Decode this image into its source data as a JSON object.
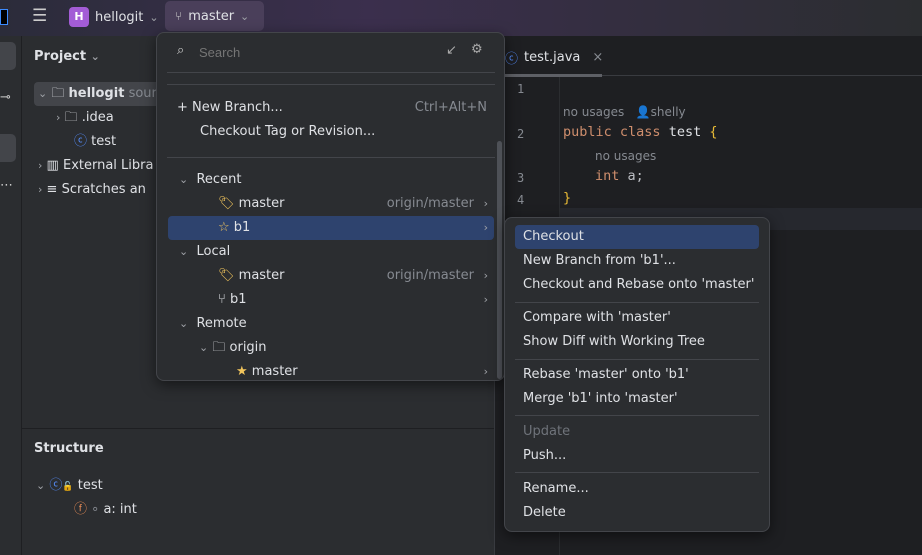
{
  "topbar": {
    "project_initial": "H",
    "project_name": "hellogit",
    "branch": "master"
  },
  "project_panel": {
    "title": "Project",
    "tree": [
      {
        "label": "hellogit",
        "suffix": "sour"
      },
      {
        "label": ".idea"
      },
      {
        "label": "test"
      },
      {
        "label": "External Libra"
      },
      {
        "label": "Scratches an"
      }
    ]
  },
  "structure_panel": {
    "title": "Structure",
    "items": [
      {
        "label": "test"
      },
      {
        "label": "a: int"
      }
    ]
  },
  "editor": {
    "tab": "test.java",
    "line_numbers": [
      "1",
      "2",
      "3",
      "4"
    ],
    "hint1": "no usages",
    "author": "shelly",
    "line2_kw1": "public",
    "line2_kw2": "class",
    "line2_name": "test",
    "line2_brace": "{",
    "hint2": "no usages",
    "line3_kw": "int",
    "line3_rest": "a;",
    "line4": "}"
  },
  "branch_popup": {
    "search_placeholder": "Search",
    "new_branch": "New Branch...",
    "new_branch_shortcut": "Ctrl+Alt+N",
    "checkout_tag": "Checkout Tag or Revision...",
    "recent": "Recent",
    "recent_items": [
      {
        "name": "master",
        "tracking": "origin/master"
      },
      {
        "name": "b1",
        "tracking": ""
      }
    ],
    "local": "Local",
    "local_items": [
      {
        "name": "master",
        "tracking": "origin/master"
      },
      {
        "name": "b1",
        "tracking": ""
      }
    ],
    "remote": "Remote",
    "remote_group": "origin",
    "remote_items": [
      {
        "name": "master"
      }
    ]
  },
  "context_menu": {
    "items": [
      "Checkout",
      "New Branch from 'b1'...",
      "Checkout and Rebase onto 'master'",
      "Compare with 'master'",
      "Show Diff with Working Tree",
      "Rebase 'master' onto 'b1'",
      "Merge 'b1' into 'master'",
      "Update",
      "Push...",
      "Rename...",
      "Delete"
    ]
  },
  "colors": {
    "accent": "#2e436e",
    "project_badge": "#a35cd6",
    "star": "#f2c55c"
  }
}
